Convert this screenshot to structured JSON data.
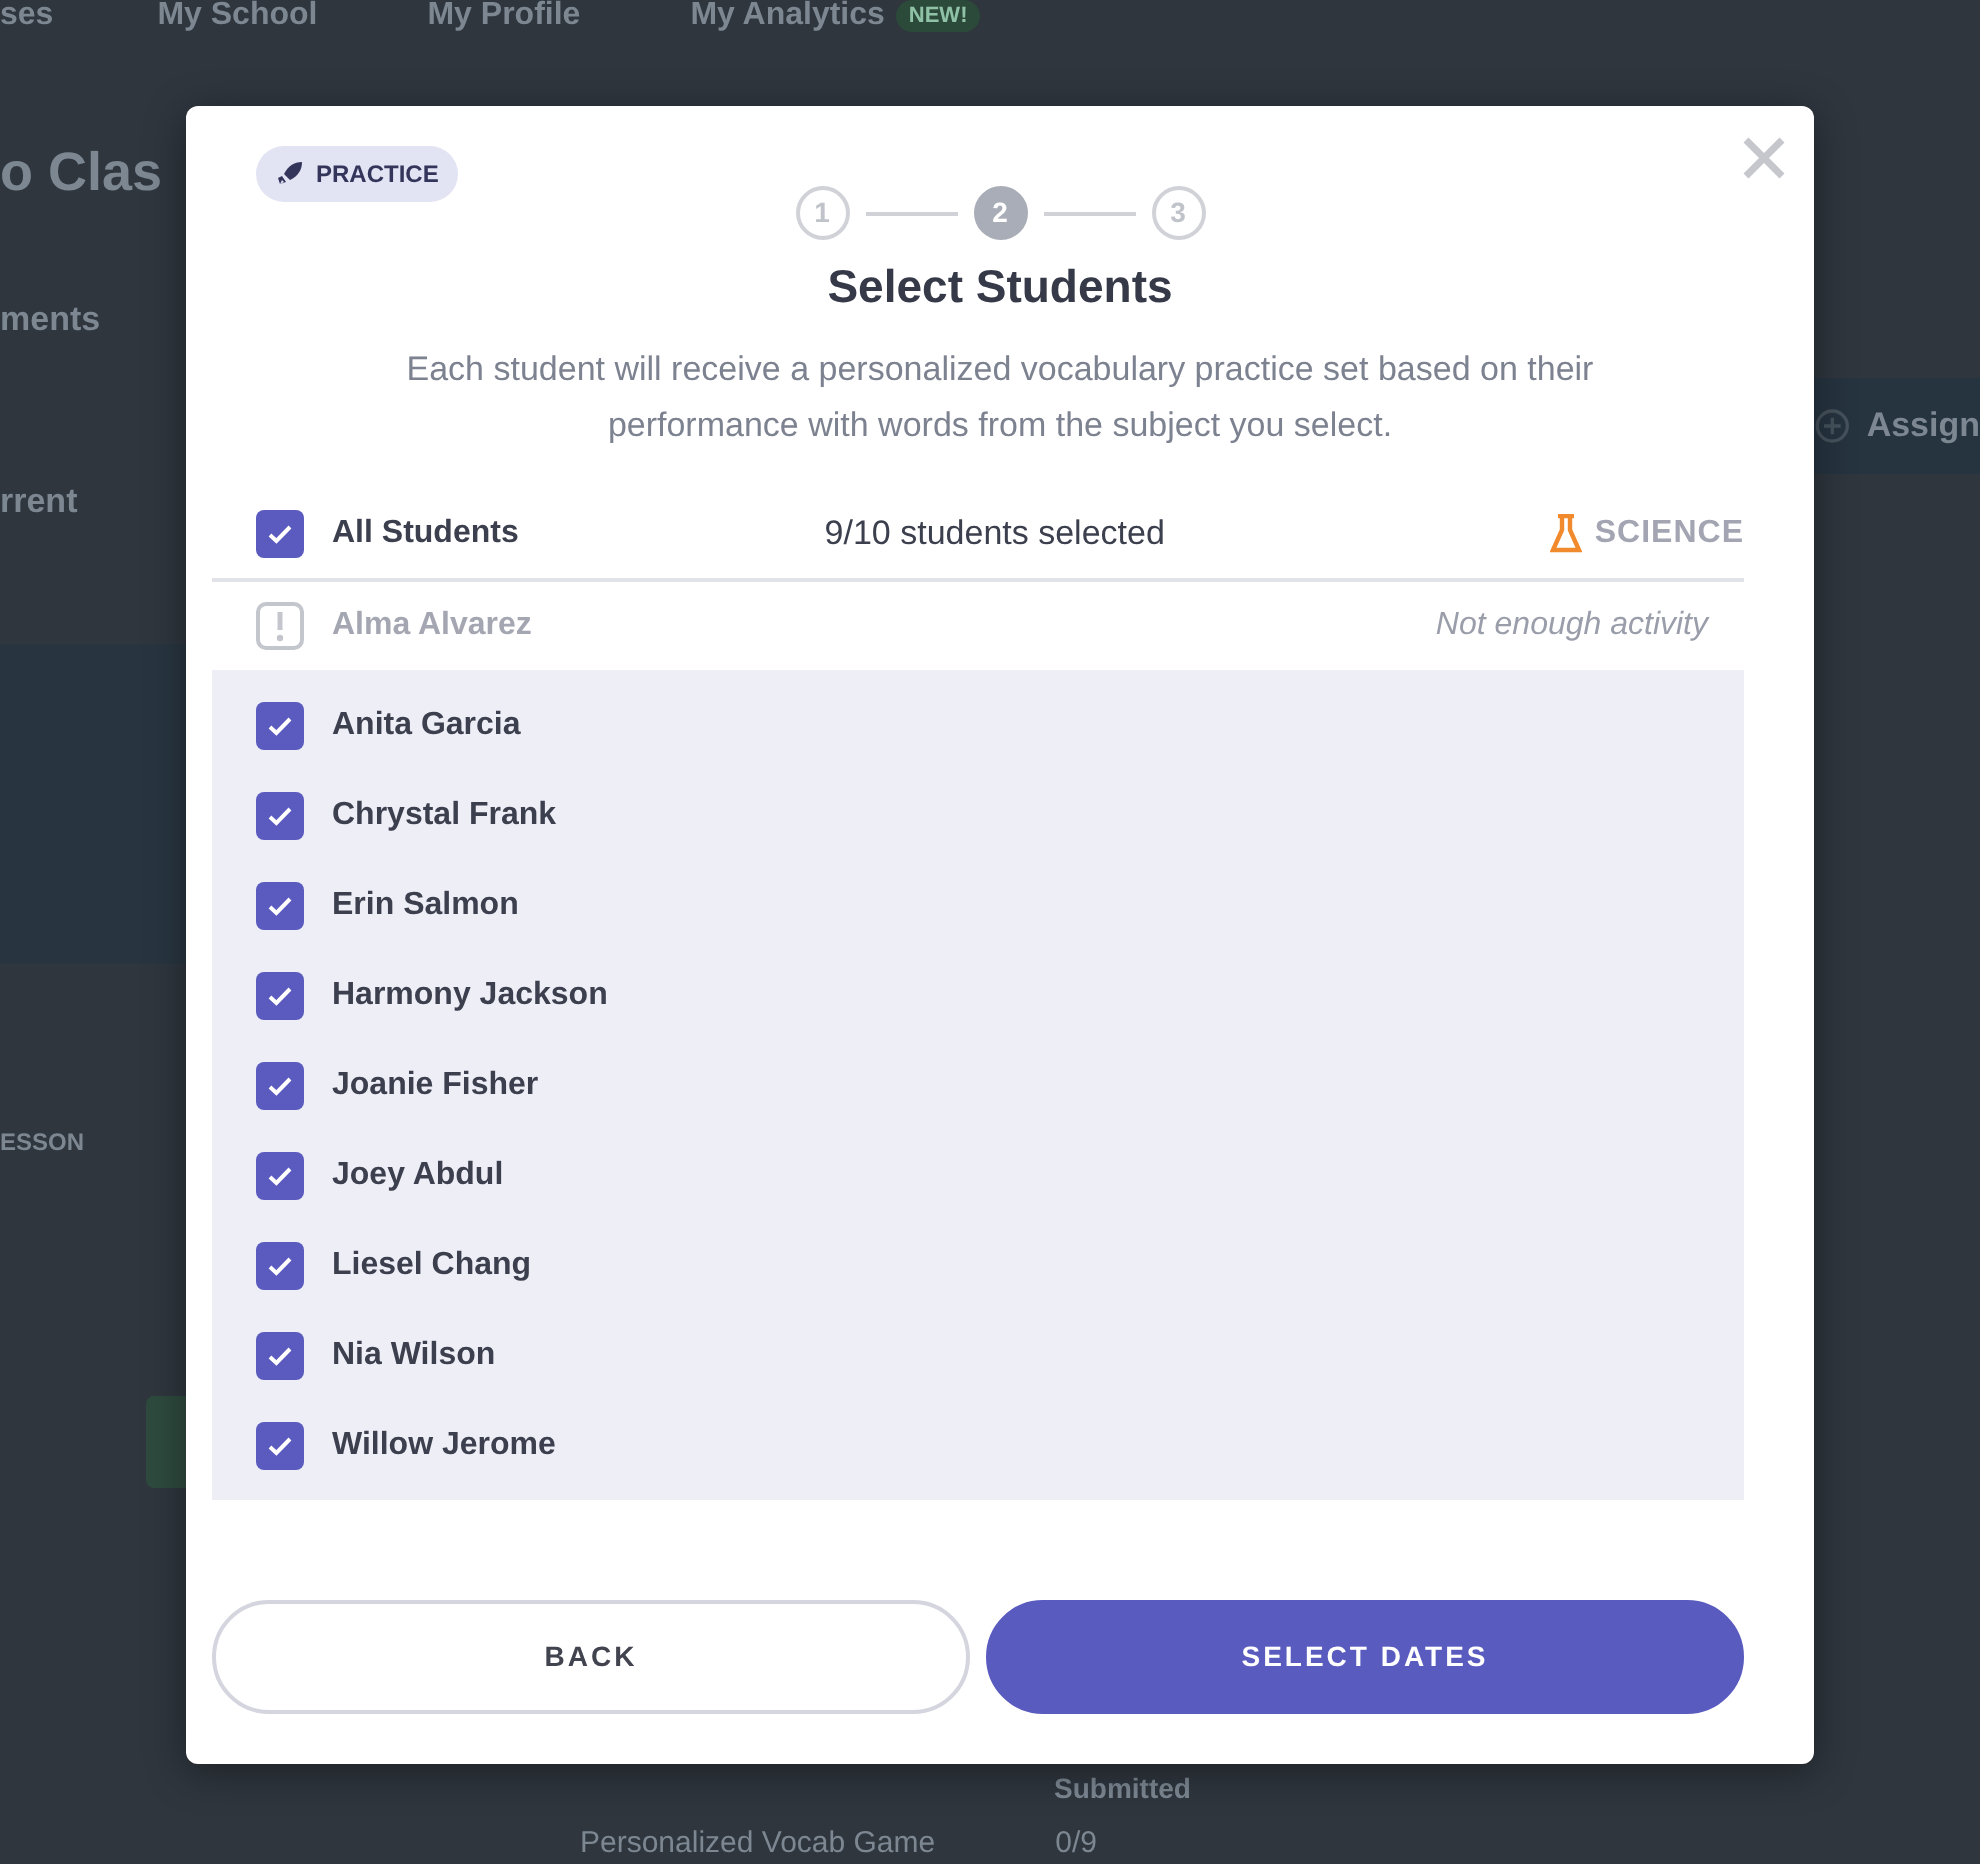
{
  "background": {
    "nav": [
      {
        "label": "ses"
      },
      {
        "label": "My School"
      },
      {
        "label": "My Profile"
      },
      {
        "label": "My Analytics",
        "badge": "NEW!"
      }
    ],
    "page_title": "o Clas",
    "tab": "ments",
    "filter": "rrent",
    "lesson_label": "ESSON",
    "assign_button": "Assign",
    "table_header": "Submitted",
    "table_row": {
      "activity": "Personalized Vocab Game",
      "count": "0/9"
    }
  },
  "modal": {
    "badge": "PRACTICE",
    "steps": [
      {
        "label": "1",
        "selected": false
      },
      {
        "label": "2",
        "selected": true
      },
      {
        "label": "3",
        "selected": false
      }
    ],
    "title": "Select Students",
    "description": "Each student will receive a personalized vocabulary practice set based on their performance with words from the subject you select.",
    "all_students": {
      "label": "All Students",
      "checked": true
    },
    "selected_count": "9/10 students selected",
    "subject": "SCIENCE",
    "students": [
      {
        "name": "Alma Alvarez",
        "kind": "unavailable",
        "note": "Not enough activity"
      },
      {
        "name": "Anita Garcia",
        "kind": "student",
        "checked": true
      },
      {
        "name": "Chrystal Frank",
        "kind": "student",
        "checked": true
      },
      {
        "name": "Erin Salmon",
        "kind": "student",
        "checked": true
      },
      {
        "name": "Harmony Jackson",
        "kind": "student",
        "checked": true
      },
      {
        "name": "Joanie Fisher",
        "kind": "student",
        "checked": true
      },
      {
        "name": "Joey Abdul",
        "kind": "student",
        "checked": true
      },
      {
        "name": "Liesel Chang",
        "kind": "student",
        "checked": true
      },
      {
        "name": "Nia Wilson",
        "kind": "student",
        "checked": true
      },
      {
        "name": "Willow Jerome",
        "kind": "student",
        "checked": true
      }
    ],
    "buttons": [
      {
        "label": "BACK",
        "kind": "secondary"
      },
      {
        "label": "SELECT DATES",
        "kind": "primary"
      }
    ]
  }
}
